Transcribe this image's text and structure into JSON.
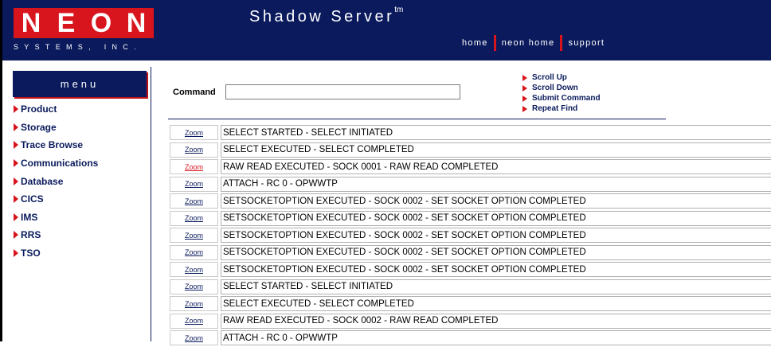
{
  "brand": {
    "letters": [
      "N",
      "E",
      "O",
      "N"
    ],
    "subtitle": "SYSTEMS, INC."
  },
  "header": {
    "title": "Shadow Server",
    "trademark": "tm",
    "nav": [
      "home",
      "neon home",
      "support"
    ]
  },
  "sidebar": {
    "heading": "menu",
    "items": [
      {
        "label": "Product"
      },
      {
        "label": "Storage"
      },
      {
        "label": "Trace Browse"
      },
      {
        "label": "Communications"
      },
      {
        "label": "Database"
      },
      {
        "label": "CICS"
      },
      {
        "label": "IMS"
      },
      {
        "label": "RRS"
      },
      {
        "label": "TSO"
      }
    ]
  },
  "command": {
    "label": "Command",
    "value": "",
    "actions": [
      "Scroll Up",
      "Scroll Down",
      "Submit Command",
      "Repeat Find"
    ]
  },
  "trace": {
    "zoom_label": "Zoom",
    "rows": [
      {
        "text": "SELECT STARTED - SELECT INITIATED",
        "active": false
      },
      {
        "text": "SELECT EXECUTED - SELECT COMPLETED",
        "active": false
      },
      {
        "text": "RAW READ EXECUTED - SOCK 0001 - RAW READ COMPLETED",
        "active": true
      },
      {
        "text": "ATTACH - RC 0 - OPWWTP",
        "active": false
      },
      {
        "text": "SETSOCKETOPTION EXECUTED - SOCK 0002 - SET SOCKET OPTION COMPLETED",
        "active": false
      },
      {
        "text": "SETSOCKETOPTION EXECUTED - SOCK 0002 - SET SOCKET OPTION COMPLETED",
        "active": false
      },
      {
        "text": "SETSOCKETOPTION EXECUTED - SOCK 0002 - SET SOCKET OPTION COMPLETED",
        "active": false
      },
      {
        "text": "SETSOCKETOPTION EXECUTED - SOCK 0002 - SET SOCKET OPTION COMPLETED",
        "active": false
      },
      {
        "text": "SETSOCKETOPTION EXECUTED - SOCK 0002 - SET SOCKET OPTION COMPLETED",
        "active": false
      },
      {
        "text": "SELECT STARTED - SELECT INITIATED",
        "active": false
      },
      {
        "text": "SELECT EXECUTED - SELECT COMPLETED",
        "active": false
      },
      {
        "text": "RAW READ EXECUTED - SOCK 0002 - RAW READ COMPLETED",
        "active": false
      },
      {
        "text": "ATTACH - RC 0 - OPWWTP",
        "active": false
      }
    ]
  },
  "colors": {
    "navy": "#0a1a5c",
    "brand_red": "#d8141c"
  }
}
